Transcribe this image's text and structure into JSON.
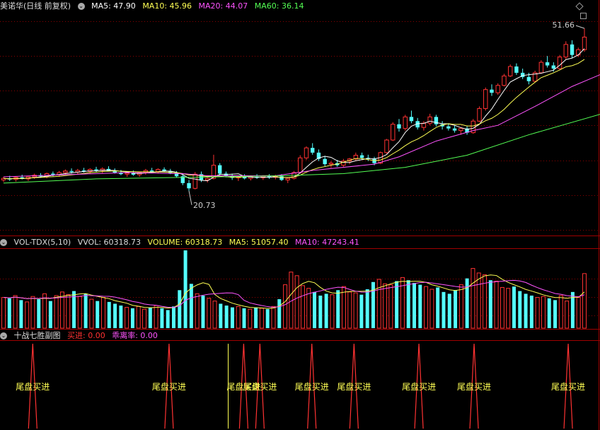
{
  "price_header": {
    "title": "美诺华(日线 前复权)",
    "ma5": "MA5: 47.90",
    "ma10": "MA10: 45.96",
    "ma20": "MA20: 44.07",
    "ma60": "MA60: 36.14"
  },
  "vol_header": {
    "title": "VOL-TDX(5,10)",
    "vvol": "VVOL: 60318.73",
    "volume": "VOLUME: 60318.73",
    "ma5": "MA5: 51057.40",
    "ma10": "MA10: 47243.41"
  },
  "ind_header": {
    "title": "十战七胜副图",
    "buy": "买进: 0.00",
    "dev": "乖离率: 0.00"
  },
  "colors": {
    "up": "#ff3232",
    "down": "#54fcfc",
    "ma5": "#ffffff",
    "ma10": "#ffff54",
    "ma20": "#ff54ff",
    "ma60": "#54ff54",
    "grid": "#8b0000",
    "buy": "#ff3232",
    "dev": "#ff54ff"
  },
  "chart_data": [
    {
      "type": "candlestick",
      "title": "美诺华(日线 前复权)",
      "ylim": [
        17.2,
        54.1
      ],
      "high_marker": "51.66",
      "low_marker": "20.73",
      "candles": [
        {
          "o": 22.8,
          "h": 23.4,
          "l": 22.4,
          "c": 23.1
        },
        {
          "o": 23.1,
          "h": 23.6,
          "l": 22.6,
          "c": 22.9
        },
        {
          "o": 22.9,
          "h": 23.5,
          "l": 22.5,
          "c": 23.3
        },
        {
          "o": 23.3,
          "h": 23.8,
          "l": 22.9,
          "c": 23.0
        },
        {
          "o": 23.0,
          "h": 23.6,
          "l": 22.6,
          "c": 23.4
        },
        {
          "o": 23.4,
          "h": 24.0,
          "l": 23.0,
          "c": 23.7
        },
        {
          "o": 23.7,
          "h": 24.1,
          "l": 23.2,
          "c": 23.5
        },
        {
          "o": 23.5,
          "h": 24.2,
          "l": 23.1,
          "c": 24.0
        },
        {
          "o": 24.0,
          "h": 24.4,
          "l": 23.5,
          "c": 23.8
        },
        {
          "o": 23.8,
          "h": 24.5,
          "l": 23.4,
          "c": 24.2
        },
        {
          "o": 24.2,
          "h": 24.8,
          "l": 23.8,
          "c": 24.5
        },
        {
          "o": 24.5,
          "h": 25.0,
          "l": 24.0,
          "c": 24.3
        },
        {
          "o": 24.3,
          "h": 24.9,
          "l": 23.9,
          "c": 24.6
        },
        {
          "o": 24.6,
          "h": 25.1,
          "l": 24.2,
          "c": 24.4
        },
        {
          "o": 24.4,
          "h": 25.0,
          "l": 24.0,
          "c": 24.8
        },
        {
          "o": 24.8,
          "h": 25.3,
          "l": 24.3,
          "c": 24.6
        },
        {
          "o": 24.6,
          "h": 25.2,
          "l": 24.1,
          "c": 24.9
        },
        {
          "o": 24.9,
          "h": 25.4,
          "l": 24.4,
          "c": 24.5
        },
        {
          "o": 24.5,
          "h": 25.0,
          "l": 24.0,
          "c": 24.2
        },
        {
          "o": 24.2,
          "h": 24.7,
          "l": 23.7,
          "c": 23.9
        },
        {
          "o": 23.9,
          "h": 24.4,
          "l": 23.4,
          "c": 24.1
        },
        {
          "o": 24.1,
          "h": 24.6,
          "l": 23.6,
          "c": 23.8
        },
        {
          "o": 23.8,
          "h": 24.4,
          "l": 23.4,
          "c": 24.2
        },
        {
          "o": 24.2,
          "h": 24.9,
          "l": 23.8,
          "c": 24.6
        },
        {
          "o": 24.6,
          "h": 25.1,
          "l": 24.2,
          "c": 24.4
        },
        {
          "o": 24.4,
          "h": 25.0,
          "l": 24.0,
          "c": 24.8
        },
        {
          "o": 24.8,
          "h": 25.2,
          "l": 24.3,
          "c": 24.5
        },
        {
          "o": 24.5,
          "h": 24.9,
          "l": 23.9,
          "c": 24.1
        },
        {
          "o": 24.1,
          "h": 24.5,
          "l": 23.3,
          "c": 23.5
        },
        {
          "o": 23.5,
          "h": 23.9,
          "l": 21.8,
          "c": 22.2
        },
        {
          "o": 22.2,
          "h": 22.8,
          "l": 20.73,
          "c": 21.2
        },
        {
          "o": 21.2,
          "h": 24.3,
          "l": 21.0,
          "c": 23.9
        },
        {
          "o": 23.9,
          "h": 24.4,
          "l": 22.4,
          "c": 22.8
        },
        {
          "o": 22.8,
          "h": 23.4,
          "l": 22.3,
          "c": 23.1
        },
        {
          "o": 23.1,
          "h": 27.6,
          "l": 22.9,
          "c": 25.6
        },
        {
          "o": 25.6,
          "h": 26.0,
          "l": 23.6,
          "c": 24.0
        },
        {
          "o": 24.0,
          "h": 24.4,
          "l": 23.3,
          "c": 23.6
        },
        {
          "o": 23.6,
          "h": 24.0,
          "l": 22.8,
          "c": 23.2
        },
        {
          "o": 23.2,
          "h": 23.6,
          "l": 22.6,
          "c": 23.4
        },
        {
          "o": 23.4,
          "h": 23.9,
          "l": 22.9,
          "c": 23.1
        },
        {
          "o": 23.1,
          "h": 23.6,
          "l": 22.7,
          "c": 23.4
        },
        {
          "o": 23.4,
          "h": 23.9,
          "l": 23.0,
          "c": 23.2
        },
        {
          "o": 23.2,
          "h": 23.7,
          "l": 22.8,
          "c": 23.5
        },
        {
          "o": 23.5,
          "h": 23.9,
          "l": 23.0,
          "c": 23.3
        },
        {
          "o": 23.3,
          "h": 23.8,
          "l": 22.9,
          "c": 23.5
        },
        {
          "o": 23.5,
          "h": 23.9,
          "l": 22.6,
          "c": 22.8
        },
        {
          "o": 22.8,
          "h": 23.3,
          "l": 22.2,
          "c": 23.1
        },
        {
          "o": 23.1,
          "h": 24.5,
          "l": 22.9,
          "c": 24.2
        },
        {
          "o": 24.2,
          "h": 27.5,
          "l": 24.0,
          "c": 27.0
        },
        {
          "o": 27.0,
          "h": 29.2,
          "l": 26.6,
          "c": 28.9
        },
        {
          "o": 28.9,
          "h": 29.8,
          "l": 27.6,
          "c": 28.0
        },
        {
          "o": 28.0,
          "h": 28.6,
          "l": 26.4,
          "c": 26.8
        },
        {
          "o": 26.8,
          "h": 27.4,
          "l": 25.4,
          "c": 25.8
        },
        {
          "o": 25.8,
          "h": 26.4,
          "l": 25.1,
          "c": 26.0
        },
        {
          "o": 26.0,
          "h": 26.6,
          "l": 25.3,
          "c": 25.6
        },
        {
          "o": 25.6,
          "h": 26.8,
          "l": 25.3,
          "c": 26.4
        },
        {
          "o": 26.4,
          "h": 27.0,
          "l": 25.8,
          "c": 26.8
        },
        {
          "o": 26.8,
          "h": 28.0,
          "l": 26.4,
          "c": 27.5
        },
        {
          "o": 27.5,
          "h": 28.0,
          "l": 26.6,
          "c": 27.0
        },
        {
          "o": 27.0,
          "h": 27.6,
          "l": 26.4,
          "c": 26.8
        },
        {
          "o": 26.8,
          "h": 27.2,
          "l": 25.6,
          "c": 26.0
        },
        {
          "o": 26.0,
          "h": 28.2,
          "l": 25.8,
          "c": 28.0
        },
        {
          "o": 28.0,
          "h": 30.6,
          "l": 27.8,
          "c": 30.4
        },
        {
          "o": 30.4,
          "h": 33.8,
          "l": 30.2,
          "c": 33.4
        },
        {
          "o": 33.4,
          "h": 34.4,
          "l": 32.0,
          "c": 32.6
        },
        {
          "o": 32.6,
          "h": 35.2,
          "l": 32.2,
          "c": 34.8
        },
        {
          "o": 34.8,
          "h": 36.0,
          "l": 33.6,
          "c": 34.0
        },
        {
          "o": 34.0,
          "h": 34.6,
          "l": 32.4,
          "c": 32.8
        },
        {
          "o": 32.8,
          "h": 34.0,
          "l": 32.2,
          "c": 33.6
        },
        {
          "o": 33.6,
          "h": 35.4,
          "l": 33.2,
          "c": 34.8
        },
        {
          "o": 34.8,
          "h": 35.2,
          "l": 33.0,
          "c": 33.4
        },
        {
          "o": 33.4,
          "h": 34.0,
          "l": 32.4,
          "c": 33.0
        },
        {
          "o": 33.0,
          "h": 33.6,
          "l": 32.2,
          "c": 32.6
        },
        {
          "o": 32.6,
          "h": 33.2,
          "l": 31.8,
          "c": 32.2
        },
        {
          "o": 32.2,
          "h": 32.8,
          "l": 31.4,
          "c": 32.6
        },
        {
          "o": 32.6,
          "h": 33.0,
          "l": 31.4,
          "c": 31.8
        },
        {
          "o": 31.8,
          "h": 34.4,
          "l": 31.6,
          "c": 34.0
        },
        {
          "o": 34.0,
          "h": 36.8,
          "l": 33.8,
          "c": 36.4
        },
        {
          "o": 36.4,
          "h": 40.4,
          "l": 36.0,
          "c": 40.0
        },
        {
          "o": 40.0,
          "h": 41.0,
          "l": 38.8,
          "c": 39.4
        },
        {
          "o": 39.4,
          "h": 41.2,
          "l": 39.0,
          "c": 40.8
        },
        {
          "o": 40.8,
          "h": 43.0,
          "l": 40.6,
          "c": 42.6
        },
        {
          "o": 42.6,
          "h": 44.8,
          "l": 42.4,
          "c": 44.4
        },
        {
          "o": 44.4,
          "h": 45.0,
          "l": 42.8,
          "c": 43.2
        },
        {
          "o": 43.2,
          "h": 44.0,
          "l": 42.0,
          "c": 42.4
        },
        {
          "o": 42.4,
          "h": 43.2,
          "l": 41.0,
          "c": 41.6
        },
        {
          "o": 41.6,
          "h": 43.6,
          "l": 41.4,
          "c": 43.2
        },
        {
          "o": 43.2,
          "h": 45.6,
          "l": 43.0,
          "c": 45.2
        },
        {
          "o": 45.2,
          "h": 46.4,
          "l": 44.2,
          "c": 44.6
        },
        {
          "o": 44.6,
          "h": 45.2,
          "l": 43.4,
          "c": 44.0
        },
        {
          "o": 44.0,
          "h": 46.6,
          "l": 43.8,
          "c": 46.2
        },
        {
          "o": 46.2,
          "h": 49.2,
          "l": 45.8,
          "c": 48.6
        },
        {
          "o": 48.6,
          "h": 49.4,
          "l": 46.0,
          "c": 46.6
        },
        {
          "o": 46.6,
          "h": 48.0,
          "l": 46.2,
          "c": 47.6
        },
        {
          "o": 47.6,
          "h": 51.66,
          "l": 47.2,
          "c": 50.0
        }
      ],
      "ma_levels": [
        {
          "name": "MA20",
          "c": "#ff54ff",
          "pts": [
            [
              0,
              23.4
            ],
            [
              20,
              24.2
            ],
            [
              29,
              24.0
            ],
            [
              33,
              23.6
            ],
            [
              44,
              23.6
            ],
            [
              50,
              24.6
            ],
            [
              60,
              25.8
            ],
            [
              64,
              27.2
            ],
            [
              70,
              30.2
            ],
            [
              76,
              32.2
            ],
            [
              80,
              33.2
            ],
            [
              86,
              36.8
            ],
            [
              92,
              40.6
            ],
            [
              99,
              44.07
            ]
          ]
        },
        {
          "name": "MA60",
          "c": "#54ff54",
          "pts": [
            [
              0,
              22.2
            ],
            [
              15,
              23.0
            ],
            [
              30,
              23.3
            ],
            [
              45,
              23.6
            ],
            [
              55,
              24.0
            ],
            [
              65,
              25.2
            ],
            [
              75,
              27.5
            ],
            [
              85,
              31.4
            ],
            [
              99,
              36.14
            ]
          ]
        }
      ]
    },
    {
      "type": "bar",
      "title": "VOL-TDX(5,10)",
      "ylim": [
        0,
        86000
      ],
      "values": [
        34000,
        33000,
        36000,
        31000,
        29000,
        35000,
        32000,
        38000,
        30000,
        36000,
        40000,
        37000,
        41000,
        35000,
        38000,
        32000,
        30000,
        34000,
        29000,
        27000,
        25000,
        23000,
        22000,
        24000,
        21000,
        23000,
        25000,
        22000,
        20000,
        24000,
        42000,
        86000,
        49000,
        38000,
        36000,
        33000,
        30000,
        27000,
        25000,
        23000,
        24000,
        22000,
        21000,
        23000,
        22000,
        21000,
        24000,
        32000,
        48000,
        62000,
        58000,
        47000,
        44000,
        40000,
        36000,
        38000,
        37000,
        42000,
        46000,
        40000,
        39000,
        37000,
        43000,
        51000,
        54000,
        49000,
        48000,
        52000,
        56000,
        53000,
        50000,
        48000,
        46000,
        43000,
        45000,
        40000,
        38000,
        42000,
        48000,
        55000,
        66000,
        61000,
        59000,
        53000,
        52000,
        45000,
        44000,
        46000,
        41000,
        38000,
        36000,
        34000,
        35000,
        33000,
        31000,
        36000,
        30000,
        40000,
        34000,
        60318.73
      ]
    },
    {
      "type": "line",
      "title": "十战七胜副图",
      "signal_label": "尾盘买进",
      "signal_bars": [
        9,
        51,
        74,
        79,
        95,
        108,
        128,
        145,
        174
      ]
    }
  ]
}
